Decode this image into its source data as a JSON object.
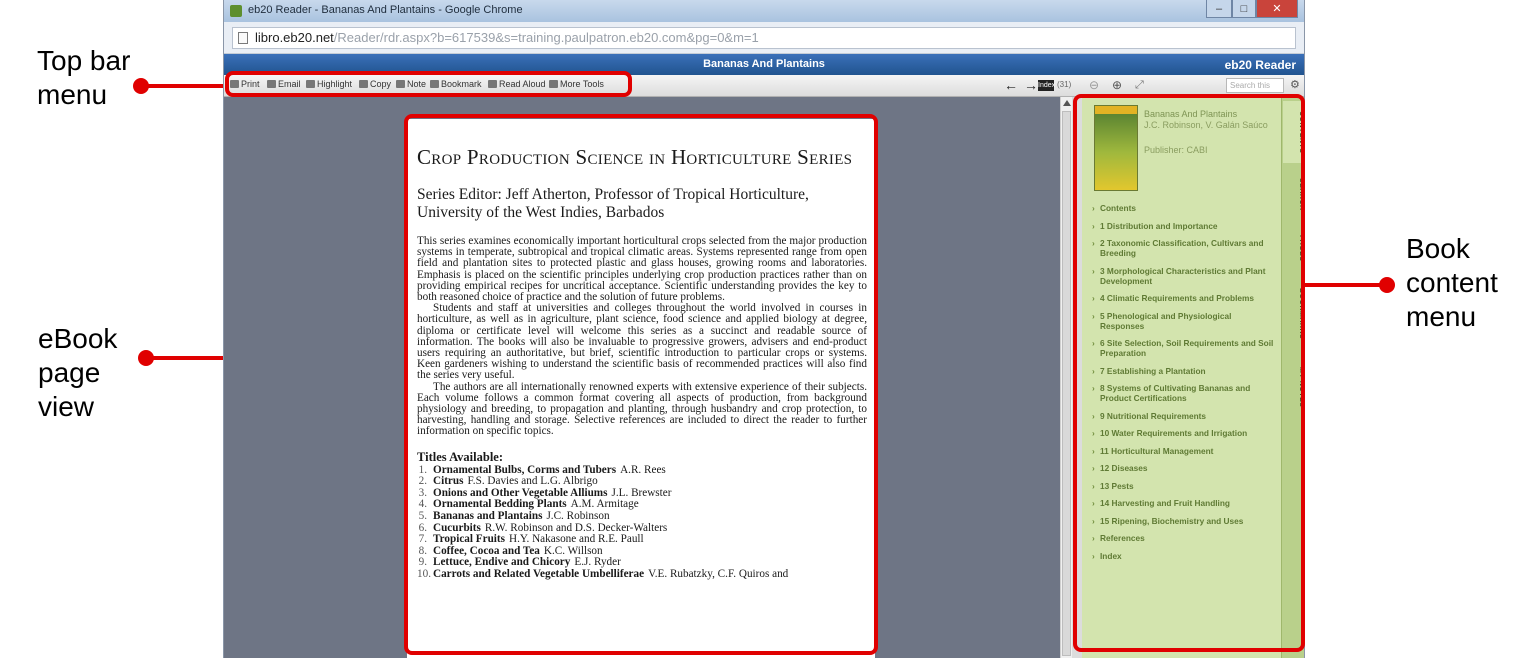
{
  "callouts": {
    "topbar": "Top bar menu",
    "pageview": "eBook page view",
    "contentmenu": "Book content menu"
  },
  "browser": {
    "title": "eb20 Reader - Bananas And Plantains - Google Chrome",
    "url_host": "libro.eb20.net",
    "url_rest": "/Reader/rdr.aspx?b=617539&s=training.paulpatron.eb20.com&pg=0&m=1"
  },
  "reader": {
    "book_title": "Bananas And Plantains",
    "brand": "eb20 Reader",
    "search_placeholder": "Search this book"
  },
  "toolbar": {
    "print": "Print",
    "email": "Email",
    "highlight": "Highlight",
    "copy": "Copy",
    "note": "Note",
    "bookmark": "Bookmark",
    "read_aloud": "Read Aloud",
    "more_tools": "More Tools",
    "page_label": "Index",
    "page_number": "(31)"
  },
  "page": {
    "series_title": "Crop Production Science in Horticulture Series",
    "editor": "Series Editor: Jeff Atherton, Professor of Tropical Horticulture, University of the West Indies, Barbados",
    "para1": "This series examines economically important horticultural crops selected from the major production systems in temperate, subtropical and tropical climatic areas. Systems represented range from open field and plantation sites to protected plastic and glass houses, growing rooms and laboratories. Emphasis is placed on the scientific principles underlying crop production practices rather than on providing empirical recipes for uncritical acceptance. Scientific understanding provides the key to both reasoned choice of practice and the solution of future problems.",
    "para2": "Students and staff at universities and colleges throughout the world involved in courses in horticulture, as well as in agriculture, plant science, food science and applied biology at degree, diploma or certificate level will welcome this series as a succinct and readable source of information. The books will also be invaluable to progressive growers, advisers and end-product users requiring an authoritative, but brief, scientific introduction to particular crops or systems. Keen gardeners wishing to understand the scientific basis of recommended practices will also find the series very useful.",
    "para3": "The authors are all internationally renowned experts with extensive experience of their subjects. Each volume follows a common format covering all aspects of production, from background physiology and breeding, to propagation and planting, through husbandry and crop protection, to harvesting, handling and storage. Selective references are included to direct the reader to further information on specific topics.",
    "titles_heading": "Titles Available:",
    "titles": [
      {
        "n": "1.",
        "title": "Ornamental Bulbs, Corms and Tubers",
        "author": "A.R. Rees"
      },
      {
        "n": "2.",
        "title": "Citrus",
        "author": "F.S. Davies and L.G. Albrigo"
      },
      {
        "n": "3.",
        "title": "Onions and Other Vegetable Alliums",
        "author": "J.L. Brewster"
      },
      {
        "n": "4.",
        "title": "Ornamental Bedding Plants",
        "author": "A.M. Armitage"
      },
      {
        "n": "5.",
        "title": "Bananas and Plantains",
        "author": "J.C. Robinson"
      },
      {
        "n": "6.",
        "title": "Cucurbits",
        "author": "R.W. Robinson and D.S. Decker-Walters"
      },
      {
        "n": "7.",
        "title": "Tropical Fruits",
        "author": "H.Y. Nakasone and R.E. Paull"
      },
      {
        "n": "8.",
        "title": "Coffee, Cocoa and Tea",
        "author": "K.C. Willson"
      },
      {
        "n": "9.",
        "title": "Lettuce, Endive and Chicory",
        "author": "E.J. Ryder"
      },
      {
        "n": "10.",
        "title": "Carrots and Related Vegetable Umbelliferae",
        "author": "V.E. Rubatzky, C.F. Quiros and"
      }
    ]
  },
  "panel": {
    "book_title": "Bananas And Plantains",
    "author": "J.C. Robinson, V. Galán Saúco",
    "publisher": "Publisher: CABI",
    "toc": [
      "Contents",
      "1 Distribution and Importance",
      "2 Taxonomic Classification, Cultivars and Breeding",
      "3 Morphological Characteristics and Plant Development",
      "4 Climatic Requirements and Problems",
      "5 Phenological and Physiological Responses",
      "6 Site Selection, Soil Requirements and Soil Preparation",
      "7 Establishing a Plantation",
      "8 Systems of Cultivating Bananas and Product Certifications",
      "9 Nutritional Requirements",
      "10 Water Requirements and Irrigation",
      "11 Horticultural Management",
      "12 Diseases",
      "13 Pests",
      "14 Harvesting and Fruit Handling",
      "15 Ripening, Biochemistry and Uses",
      "References",
      "Index"
    ],
    "tabs": [
      "CONTENTS",
      "SEARCH",
      "PAGES",
      "BOOKMARKS",
      "MY NOTES"
    ]
  }
}
